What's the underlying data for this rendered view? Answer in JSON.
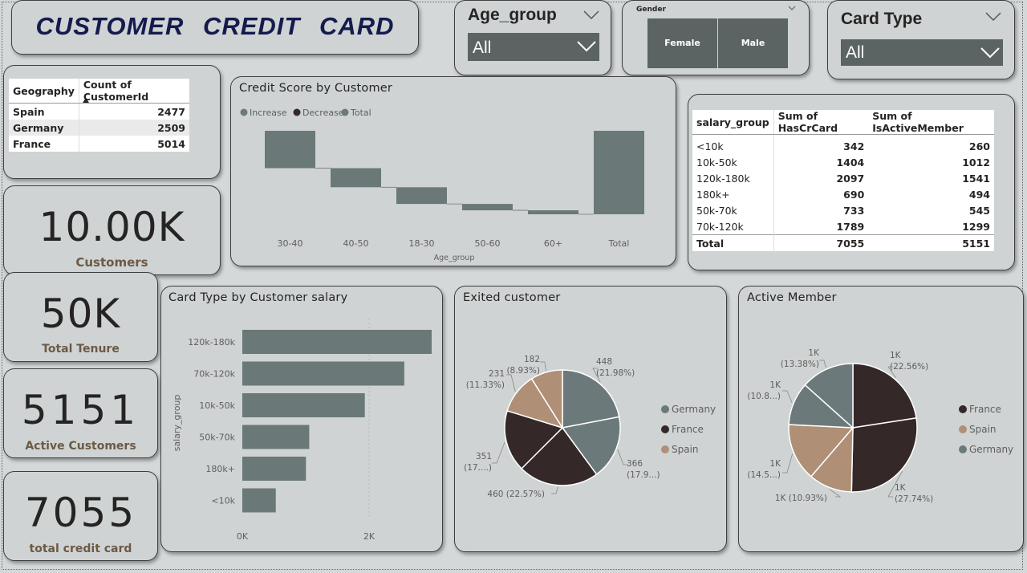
{
  "title": "CUSTOMER   CREDIT   CARD",
  "slicers": {
    "age_group": {
      "label": "Age_group",
      "value": "All"
    },
    "gender": {
      "label": "Gender",
      "options": [
        "Female",
        "Male"
      ]
    },
    "card_type": {
      "label": "Card Type",
      "value": "All"
    }
  },
  "geo_table": {
    "headers": [
      "Geography",
      "Count of CustomerId"
    ],
    "rows": [
      [
        "Spain",
        "2477"
      ],
      [
        "Germany",
        "2509"
      ],
      [
        "France",
        "5014"
      ]
    ]
  },
  "kpis": {
    "customers": {
      "value": "10.00K",
      "label": "Customers"
    },
    "tenure": {
      "value": "50K",
      "label": "Total Tenure"
    },
    "active": {
      "value": "5151",
      "label": "Active Customers"
    },
    "credit": {
      "value": "7055",
      "label": "total credit card"
    }
  },
  "salary_table": {
    "headers": [
      "salary_group",
      "Sum of HasCrCard",
      "Sum of IsActiveMember"
    ],
    "rows": [
      [
        "<10k",
        "342",
        "260"
      ],
      [
        "10k-50k",
        "1404",
        "1012"
      ],
      [
        "120k-180k",
        "2097",
        "1541"
      ],
      [
        "180k+",
        "690",
        "494"
      ],
      [
        "50k-70k",
        "733",
        "545"
      ],
      [
        "70k-120k",
        "1789",
        "1299"
      ]
    ],
    "total": [
      "Total",
      "7055",
      "5151"
    ]
  },
  "colors": {
    "bar": "#6b7878",
    "dark": "#342829",
    "tan": "#b08f77",
    "slate": "#6c797a"
  },
  "chart_data": [
    {
      "type": "waterfall",
      "title": "Credit Score by Customer",
      "legend": [
        "Increase",
        "Decrease",
        "Total"
      ],
      "xlabel": "Age_group",
      "categories": [
        "30-40",
        "40-50",
        "18-30",
        "50-60",
        "60+",
        "Total"
      ],
      "values": [
        -47,
        -24,
        -21,
        -8,
        -5,
        -105
      ],
      "note": "bars relative, unlabeled axis"
    },
    {
      "type": "bar",
      "title": "Card Type by Customer salary",
      "ylabel": "salary_group",
      "categories": [
        "120k-180k",
        "70k-120k",
        "10k-50k",
        "50k-70k",
        "180k+",
        "<10k"
      ],
      "values": [
        2975,
        2545,
        1925,
        1052,
        1000,
        526
      ],
      "xticks": [
        "0K",
        "2K"
      ],
      "xlim": [
        0,
        3000
      ]
    },
    {
      "type": "pie",
      "title": "Exited customer",
      "legend": [
        "Germany",
        "France",
        "Spain"
      ],
      "slices": [
        {
          "name": "Germany",
          "value": 448,
          "label1": "448",
          "label2": "(21.98%)"
        },
        {
          "name": "Germany",
          "value": 366,
          "label1": "366",
          "label2": "(17.9...)"
        },
        {
          "name": "France",
          "value": 460,
          "label1": "460 (22.57%)",
          "label2": ""
        },
        {
          "name": "France",
          "value": 351,
          "label1": "351",
          "label2": "(17....)"
        },
        {
          "name": "Spain",
          "value": 231,
          "label1": "231",
          "label2": "(11.33%)"
        },
        {
          "name": "Spain",
          "value": 182,
          "label1": "182",
          "label2": "(8.93%)"
        }
      ]
    },
    {
      "type": "pie",
      "title": "Active Member",
      "legend": [
        "France",
        "Spain",
        "Germany"
      ],
      "slices": [
        {
          "name": "France",
          "value": 22.56,
          "label1": "1K",
          "label2": "(22.56%)"
        },
        {
          "name": "France",
          "value": 27.74,
          "label1": "1K",
          "label2": "(27.74%)"
        },
        {
          "name": "Spain",
          "value": 10.93,
          "label1": "1K (10.93%)",
          "label2": ""
        },
        {
          "name": "Spain",
          "value": 14.5,
          "label1": "1K",
          "label2": "(14.5...)"
        },
        {
          "name": "Germany",
          "value": 10.8,
          "label1": "1K",
          "label2": "(10.8...)"
        },
        {
          "name": "Germany",
          "value": 13.38,
          "label1": "1K",
          "label2": "(13.38%)"
        }
      ]
    }
  ]
}
